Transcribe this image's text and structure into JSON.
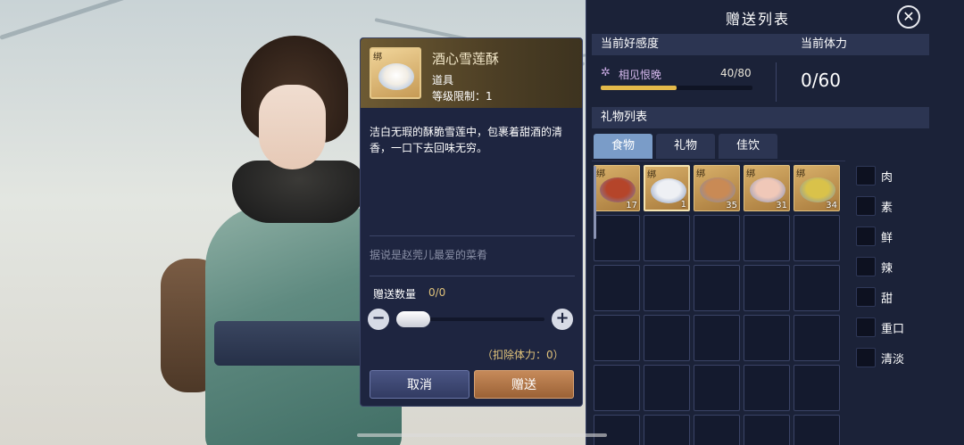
{
  "detail": {
    "item_name": "酒心雪莲酥",
    "bind_tag": "绑",
    "item_type": "道具",
    "level_limit": "等级限制：1",
    "description": "洁白无瑕的酥脆雪莲中，包裹着甜酒的清香，一口下去回味无穷。",
    "flavor_text": "据说是赵莞儿最爱的菜肴",
    "quantity_label": "赠送数量",
    "quantity_value": "0/0",
    "minus_symbol": "−",
    "plus_symbol": "+",
    "stamina_deduct": "（扣除体力：0）",
    "cancel_label": "取消",
    "send_label": "赠送"
  },
  "panel": {
    "title": "赠送列表",
    "close_symbol": "✕",
    "favor_header": "当前好感度",
    "stamina_header": "当前体力",
    "favor_icon": "✲",
    "favor_name": "相见恨晚",
    "favor_count": "40/80",
    "favor_progress": 0.5,
    "stamina_value": "0/60",
    "gift_list_header": "礼物列表",
    "tabs": [
      {
        "label": "食物",
        "active": true
      },
      {
        "label": "礼物",
        "active": false
      },
      {
        "label": "佳饮",
        "active": false
      }
    ],
    "items": [
      {
        "bind": "绑",
        "count": "17",
        "dish_color": "#b5452a"
      },
      {
        "bind": "绑",
        "count": "1",
        "dish_color": "#eef0f4"
      },
      {
        "bind": "绑",
        "count": "35",
        "dish_color": "#c98a55"
      },
      {
        "bind": "绑",
        "count": "31",
        "dish_color": "#f0c8b8"
      },
      {
        "bind": "绑",
        "count": "34",
        "dish_color": "#d9c24a"
      }
    ],
    "filters": [
      "肉",
      "素",
      "鲜",
      "辣",
      "甜",
      "重口",
      "清淡"
    ]
  },
  "colors": {
    "panel_bg": "#1b2238",
    "gold_accent": "#e0c27a",
    "favor_bar": "#e3b94a",
    "send_button": "#c68a5a",
    "cancel_button": "#4a5584"
  }
}
